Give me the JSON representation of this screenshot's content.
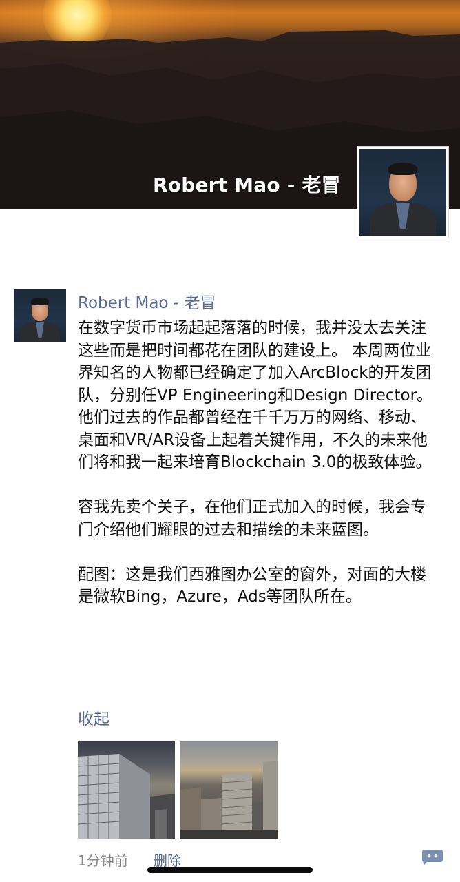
{
  "header": {
    "cover_name": "Robert Mao - 老冒"
  },
  "post": {
    "author": "Robert Mao - 老冒",
    "paragraphs": [
      "在数字货币市场起起落落的时候，我并没太去关注这些而是把时间都花在团队的建设上。 本周两位业界知名的人物都已经确定了加入ArcBlock的开发团队，分别任VP Engineering和Design Director。他们过去的作品都曾经在千千万万的网络、移动、桌面和VR/AR设备上起着关键作用，不久的未来他们将和我一起来培育Blockchain 3.0的极致体验。",
      "容我先卖个关子，在他们正式加入的时候，我会专门介绍他们耀眼的过去和描绘的未来蓝图。",
      "配图：这是我们西雅图办公室的窗外，对面的大楼是微软Bing，Azure，Ads等团队所在。"
    ],
    "collapse_label": "收起",
    "time": "1分钟前",
    "delete_label": "删除",
    "comment_icon": "comment-bubble-icon"
  },
  "colors": {
    "link": "#566b94",
    "text": "#111111",
    "meta": "#888888"
  }
}
